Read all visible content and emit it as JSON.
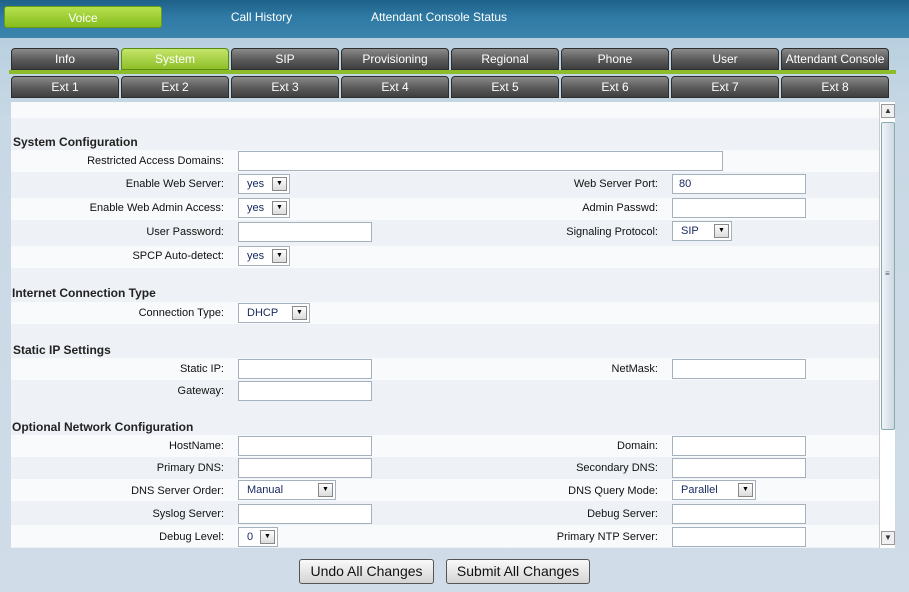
{
  "topnav": {
    "voice": "Voice",
    "call_history": "Call History",
    "attendant_status": "Attendant Console Status"
  },
  "tabs_row1": [
    "Info",
    "System",
    "SIP",
    "Provisioning",
    "Regional",
    "Phone",
    "User",
    "Attendant Console"
  ],
  "tabs_row2": [
    "Ext 1",
    "Ext 2",
    "Ext 3",
    "Ext 4",
    "Ext 5",
    "Ext 6",
    "Ext 7",
    "Ext 8"
  ],
  "active_tab": "System",
  "sections": {
    "system_config": "System Configuration",
    "internet_conn": "Internet Connection Type",
    "static_ip": "Static IP Settings",
    "optional_net": "Optional Network Configuration"
  },
  "fields": {
    "restricted_access_domains": {
      "label": "Restricted Access Domains:",
      "value": ""
    },
    "enable_web_server": {
      "label": "Enable Web Server:",
      "value": "yes"
    },
    "web_server_port": {
      "label": "Web Server Port:",
      "value": "80"
    },
    "enable_web_admin": {
      "label": "Enable Web Admin Access:",
      "value": "yes"
    },
    "admin_passwd": {
      "label": "Admin Passwd:",
      "value": ""
    },
    "user_password": {
      "label": "User Password:",
      "value": ""
    },
    "signaling_protocol": {
      "label": "Signaling Protocol:",
      "value": "SIP"
    },
    "spcp_autodetect": {
      "label": "SPCP Auto-detect:",
      "value": "yes"
    },
    "connection_type": {
      "label": "Connection Type:",
      "value": "DHCP"
    },
    "static_ip": {
      "label": "Static IP:",
      "value": ""
    },
    "netmask": {
      "label": "NetMask:",
      "value": ""
    },
    "gateway": {
      "label": "Gateway:",
      "value": ""
    },
    "hostname": {
      "label": "HostName:",
      "value": ""
    },
    "domain": {
      "label": "Domain:",
      "value": ""
    },
    "primary_dns": {
      "label": "Primary DNS:",
      "value": ""
    },
    "secondary_dns": {
      "label": "Secondary DNS:",
      "value": ""
    },
    "dns_server_order": {
      "label": "DNS Server Order:",
      "value": "Manual"
    },
    "dns_query_mode": {
      "label": "DNS Query Mode:",
      "value": "Parallel"
    },
    "syslog_server": {
      "label": "Syslog Server:",
      "value": ""
    },
    "debug_server": {
      "label": "Debug Server:",
      "value": ""
    },
    "debug_level": {
      "label": "Debug Level:",
      "value": "0"
    },
    "primary_ntp": {
      "label": "Primary NTP Server:",
      "value": ""
    }
  },
  "buttons": {
    "undo": "Undo All Changes",
    "submit": "Submit All Changes"
  }
}
